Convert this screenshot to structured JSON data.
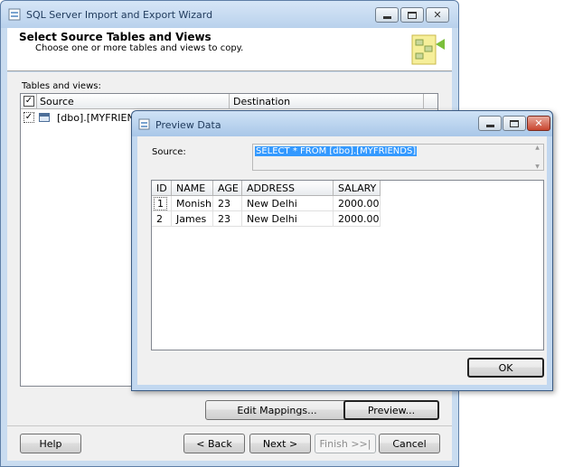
{
  "wizard": {
    "title": "SQL Server Import and Export Wizard",
    "header_title": "Select Source Tables and Views",
    "header_subtitle": "Choose one or more tables and views to copy.",
    "tables_label": "Tables and views:",
    "columns": {
      "source": "Source",
      "destination": "Destination"
    },
    "row": {
      "source": "[dbo].[MYFRIENDS",
      "checked": true
    },
    "buttons": {
      "edit_mappings": "Edit Mappings...",
      "preview": "Preview...",
      "help": "Help",
      "back": "< Back",
      "next": "Next >",
      "finish": "Finish >>|",
      "cancel": "Cancel"
    }
  },
  "preview": {
    "title": "Preview Data",
    "source_label": "Source:",
    "source_query": "SELECT * FROM [dbo].[MYFRIENDS]",
    "columns": [
      "ID",
      "NAME",
      "AGE",
      "ADDRESS",
      "SALARY"
    ],
    "rows": [
      [
        "1",
        "Monish",
        "23",
        "New Delhi",
        "2000.00"
      ],
      [
        "2",
        "James",
        "23",
        "New Delhi",
        "2000.00"
      ]
    ],
    "ok_label": "OK"
  },
  "colors": {
    "titlebar_start": "#c2d9f2",
    "titlebar_end": "#a5c4e7",
    "dialog_bg": "#f0f0f0",
    "selection": "#3399ff"
  }
}
